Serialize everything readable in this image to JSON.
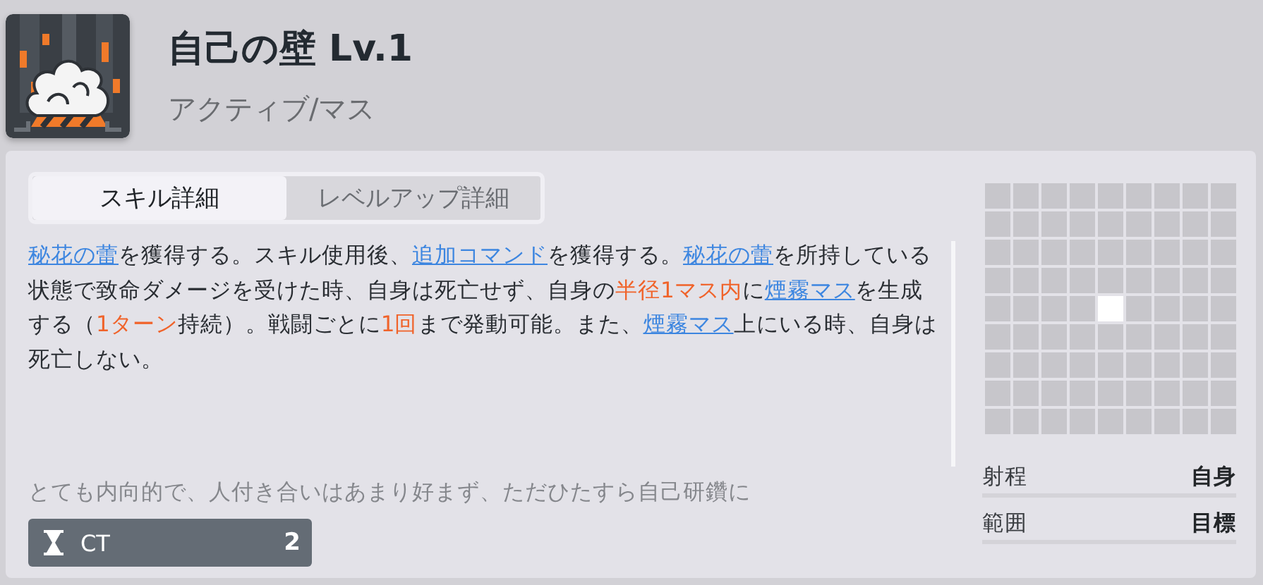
{
  "skill": {
    "title": "自己の壁 Lv.1",
    "type": "アクティブ/マス"
  },
  "tabs": [
    {
      "label": "スキル詳細",
      "selected": true
    },
    {
      "label": "レベルアップ詳細",
      "selected": false
    }
  ],
  "description": [
    {
      "kind": "link",
      "text": "秘花の蕾"
    },
    {
      "kind": "plain",
      "text": "を獲得する。スキル使用後、"
    },
    {
      "kind": "link",
      "text": "追加コマンド"
    },
    {
      "kind": "plain",
      "text": "を獲得する。"
    },
    {
      "kind": "link",
      "text": "秘花の蕾"
    },
    {
      "kind": "plain",
      "text": "を所持している状態で致命ダメージを受けた時、自身は死亡せず、自身の"
    },
    {
      "kind": "highlight",
      "text": "半径1マス内"
    },
    {
      "kind": "plain",
      "text": "に"
    },
    {
      "kind": "link",
      "text": "煙霧マス"
    },
    {
      "kind": "plain",
      "text": "を生成する（"
    },
    {
      "kind": "highlight",
      "text": "1ターン"
    },
    {
      "kind": "plain",
      "text": "持続）。戦闘ごとに"
    },
    {
      "kind": "highlight",
      "text": "1回"
    },
    {
      "kind": "plain",
      "text": "まで発動可能。また、"
    },
    {
      "kind": "link",
      "text": "煙霧マス"
    },
    {
      "kind": "plain",
      "text": "上にいる時、自身は死亡しない。"
    }
  ],
  "flavor_text": "とても内向的で、人付き合いはあまり好まず、ただひたすら自己研鑽に",
  "cooldown": {
    "label": "CT",
    "value": "2"
  },
  "range_grid": [
    [
      false,
      false,
      false,
      false,
      false,
      false,
      false,
      false,
      false
    ],
    [
      false,
      false,
      false,
      false,
      false,
      false,
      false,
      false,
      false
    ],
    [
      false,
      false,
      false,
      false,
      false,
      false,
      false,
      false,
      false
    ],
    [
      false,
      false,
      false,
      false,
      false,
      false,
      false,
      false,
      false
    ],
    [
      false,
      false,
      false,
      false,
      true,
      false,
      false,
      false,
      false
    ],
    [
      false,
      false,
      false,
      false,
      false,
      false,
      false,
      false,
      false
    ],
    [
      false,
      false,
      false,
      false,
      false,
      false,
      false,
      false,
      false
    ],
    [
      false,
      false,
      false,
      false,
      false,
      false,
      false,
      false,
      false
    ],
    [
      false,
      false,
      false,
      false,
      false,
      false,
      false,
      false,
      false
    ]
  ],
  "stats": [
    {
      "label": "射程",
      "value": "自身"
    },
    {
      "label": "範囲",
      "value": "目標"
    }
  ]
}
